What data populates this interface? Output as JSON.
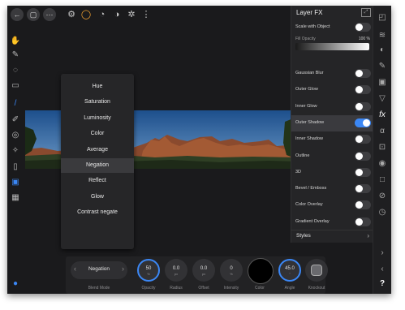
{
  "topbar": {
    "icons": [
      "back-icon",
      "document-icon",
      "more-icon",
      "persona-icon",
      "selection-icon",
      "live-filter-icon",
      "adjustment-icon",
      "settings-icon",
      "help-icon"
    ]
  },
  "panel": {
    "title": "Layer FX",
    "scale_label": "Scale with Object",
    "fill_label": "Fill Opacity",
    "fill_value": "100 %",
    "effects": [
      {
        "label": "Gaussian Blur",
        "on": false
      },
      {
        "label": "Outer Glow",
        "on": false
      },
      {
        "label": "Inner Glow",
        "on": false
      },
      {
        "label": "Outer Shadow",
        "on": true
      },
      {
        "label": "Inner Shadow",
        "on": false
      },
      {
        "label": "Outline",
        "on": false
      },
      {
        "label": "3D",
        "on": false
      },
      {
        "label": "Bevel / Emboss",
        "on": false
      },
      {
        "label": "Color Overlay",
        "on": false
      },
      {
        "label": "Gradient Overlay",
        "on": false
      }
    ],
    "styles_label": "Styles",
    "styles_chevron": "›"
  },
  "blend_menu": {
    "items": [
      "Hue",
      "Saturation",
      "Luminosity",
      "Color",
      "Average",
      "Negation",
      "Reflect",
      "Glow",
      "Contrast negate"
    ],
    "selected": "Negation"
  },
  "bottom": {
    "blend_value": "Negation",
    "blend_label": "Blend Mode",
    "arrow_left": "‹",
    "arrow_right": "›",
    "opacity_value": "50",
    "opacity_unit": "%",
    "opacity_label": "Opacity",
    "radius_value": "0.0",
    "radius_unit": "px",
    "radius_label": "Radius",
    "offset_value": "0.0",
    "offset_unit": "px",
    "offset_label": "Offset",
    "intensity_value": "0",
    "intensity_unit": "%",
    "intensity_label": "Intensity",
    "color_label": "Color",
    "color_value": "#000000",
    "angle_value": "45.0",
    "angle_unit": "°",
    "angle_label": "Angle",
    "knockout_label": "Knockout"
  },
  "right_help": "?",
  "colors": {
    "accent": "#3b87f5",
    "background": "#1c1c1e"
  }
}
